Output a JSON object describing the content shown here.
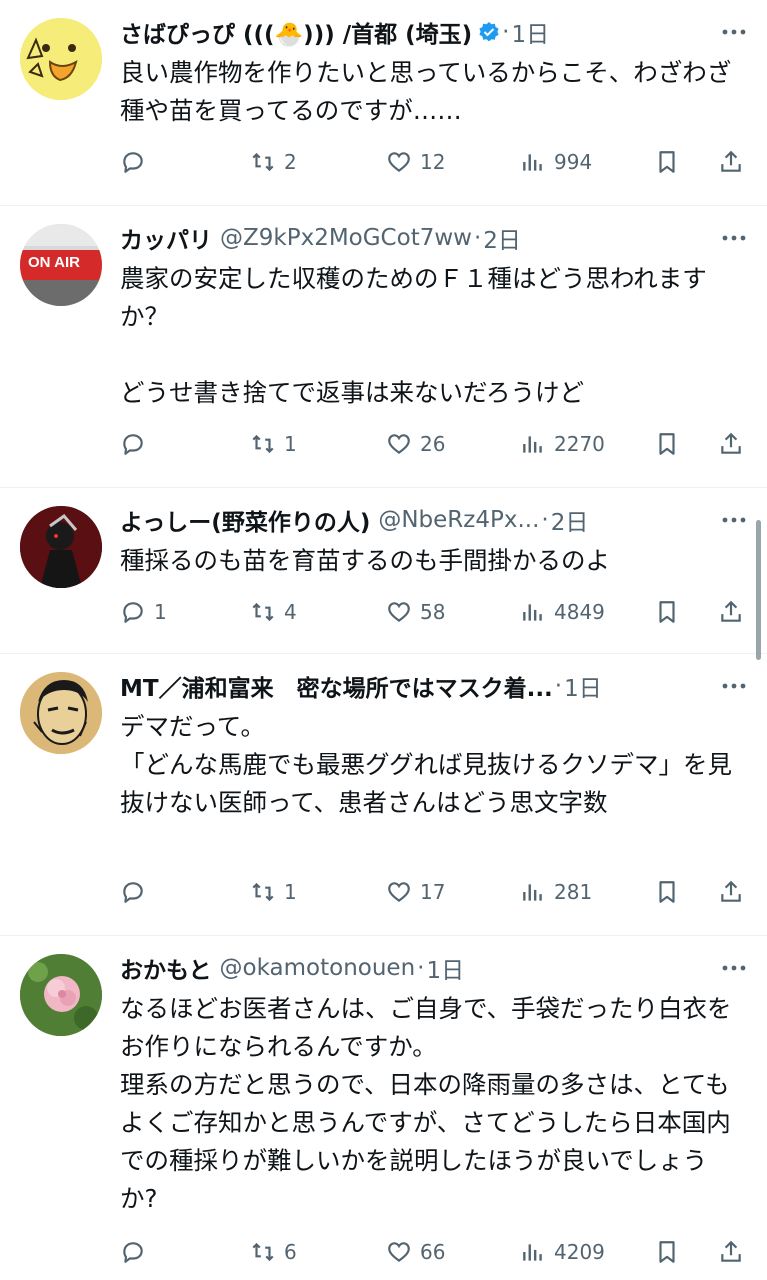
{
  "tweets": [
    {
      "name": "さばぴっぴ (((🐣))) /首都 (埼玉)",
      "handle": "",
      "verified": true,
      "dot": "·",
      "time": "1日",
      "text": "良い農作物を作りたいと思っているからこそ、わざわざ種や苗を買ってるのですが……",
      "replies": "",
      "retweets": "2",
      "likes": "12",
      "views": "994",
      "avatar": "chick-avatar"
    },
    {
      "name": "カッパリ",
      "handle": "@Z9kPx2MoGCot7ww",
      "verified": false,
      "dot": "·",
      "time": "2日",
      "text": "農家の安定した収穫のためのＦ１種はどう思われますか？\n\nどうせ書き捨てで返事は来ないだろうけど",
      "replies": "",
      "retweets": "1",
      "likes": "26",
      "views": "2270",
      "avatar": "on-air-avatar",
      "avatar_text": "ON AIR"
    },
    {
      "name": "よっしー(野菜作りの人)",
      "handle": "@NbeRz4Px...",
      "verified": false,
      "dot": "·",
      "time": "2日",
      "text": "種採るのも苗を育苗するのも手間掛かるのよ",
      "replies": "1",
      "retweets": "4",
      "likes": "58",
      "views": "4849",
      "avatar": "anime-avatar"
    },
    {
      "name": "MT／浦和富来　密な場所ではマスク着...",
      "handle": "",
      "verified": false,
      "dot": "·",
      "time": "1日",
      "text": "デマだって。\n「どんな馬鹿でも最悪ググれば見抜けるクソデマ」を見抜けない医師って、患者さんはどう思文字数",
      "replies": "",
      "retweets": "1",
      "likes": "17",
      "views": "281",
      "avatar": "portrait-avatar"
    },
    {
      "name": "おかもと",
      "handle": "@okamotonouen",
      "verified": false,
      "dot": "·",
      "time": "1日",
      "text": "なるほどお医者さんは、ご自身で、手袋だったり白衣をお作りになられるんですか。\n理系の方だと思うので、日本の降雨量の多さは、とてもよくご存知かと思うんですが、さてどうしたら日本国内での種採りが難しいかを説明したほうが良いでしょうか?",
      "replies": "",
      "retweets": "6",
      "likes": "66",
      "views": "4209",
      "avatar": "flower-avatar"
    }
  ],
  "colors": {
    "text": "#0f1419",
    "secondary": "#536471",
    "verified": "#1d9bf0",
    "divider": "#eff3f4"
  }
}
